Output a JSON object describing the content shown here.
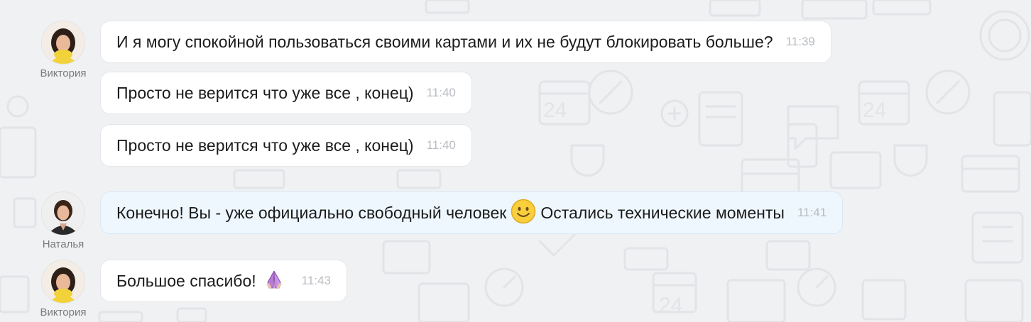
{
  "colors": {
    "background": "#f0f1f3",
    "client_bubble": "#ffffff",
    "agent_bubble": "#eef7fd",
    "time_text": "#b9bcc2"
  },
  "senders": {
    "client": "Виктория",
    "agent": "Наталья"
  },
  "messages": [
    {
      "sender": "Виктория",
      "text": "И я могу спокойной пользоваться своими картами и их не будут блокировать больше?",
      "time": "11:39"
    },
    {
      "sender": "Виктория",
      "text": "Просто не верится что уже все , конец)",
      "time": "11:40"
    },
    {
      "sender": "Виктория",
      "text": "Просто не верится что уже все , конец)",
      "time": "11:40"
    },
    {
      "sender": "Наталья",
      "text_before": "Конечно! Вы - уже официально свободный человек",
      "emoji": "smiling-face-emoji",
      "text_after": "Остались технические моменты",
      "time": "11:41"
    },
    {
      "sender": "Виктория",
      "text": "Большое спасибо!",
      "emoji": "folded-hands-emoji",
      "time": "11:43"
    }
  ]
}
